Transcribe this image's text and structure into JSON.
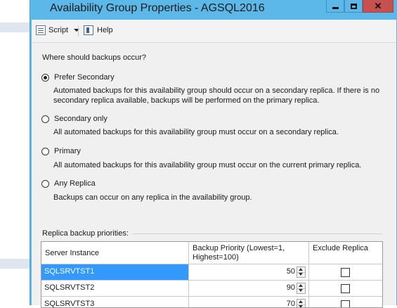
{
  "window": {
    "title": "Availability Group Properties - AGSQL2016",
    "controls": {
      "minimize": "minimize-icon",
      "maximize": "maximize-icon",
      "close": "close-icon"
    },
    "close_label": "✕"
  },
  "toolbar": {
    "script_label": "Script",
    "help_label": "Help"
  },
  "backup": {
    "question": "Where should backups occur?",
    "options": [
      {
        "label": "Prefer Secondary",
        "checked": true,
        "description": "Automated backups for this availability group should occur on a secondary replica. If there is no secondary replica available, backups will be performed on the primary replica."
      },
      {
        "label": "Secondary only",
        "checked": false,
        "description": "All automated backups for this availability group must occur on a secondary replica."
      },
      {
        "label": "Primary",
        "checked": false,
        "description": "All automated backups for this availability group must occur on the current primary replica."
      },
      {
        "label": "Any Replica",
        "checked": false,
        "description": "Backups can occur on any replica in the availability group."
      }
    ]
  },
  "priorities": {
    "group_label": "Replica backup priorities:",
    "columns": [
      "Server Instance",
      "Backup Priority (Lowest=1, Highest=100)",
      "Exclude Replica"
    ],
    "rows": [
      {
        "server": "SQLSRVTST1",
        "priority": "50",
        "exclude": false,
        "selected": true
      },
      {
        "server": "SQLSRVTST2",
        "priority": "90",
        "exclude": false,
        "selected": false
      },
      {
        "server": "SQLSRVTST3",
        "priority": "70",
        "exclude": false,
        "selected": false
      }
    ]
  },
  "colors": {
    "titlebar": "#5bb8e8",
    "close_button": "#c75050",
    "selection": "#3399ff"
  }
}
